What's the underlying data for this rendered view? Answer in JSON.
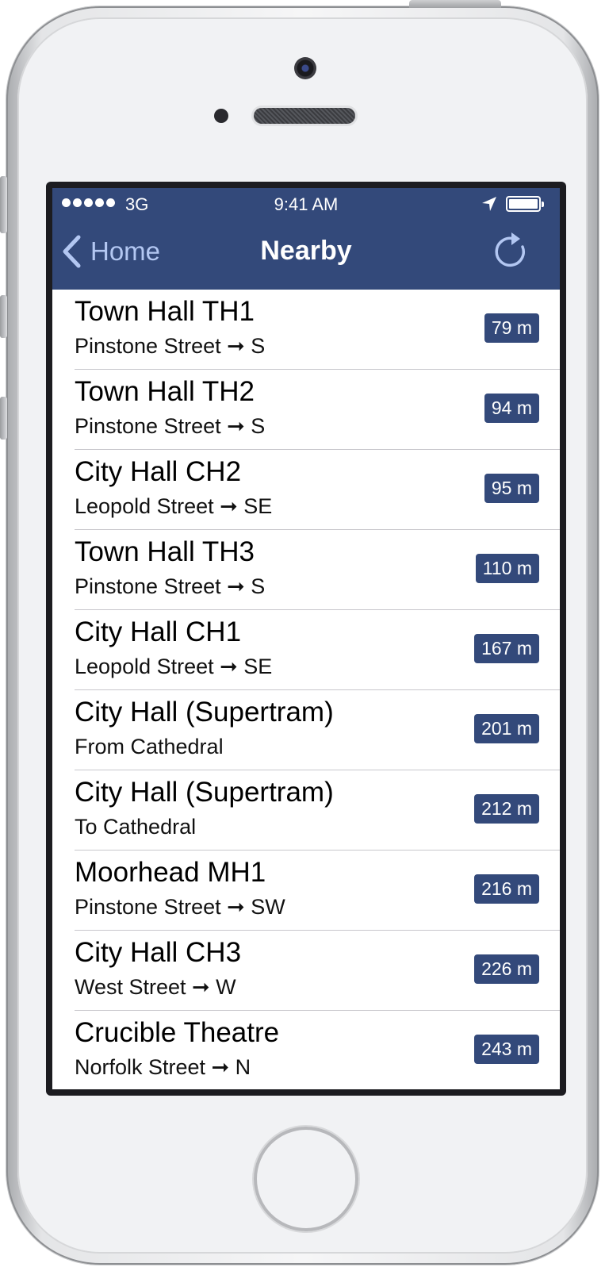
{
  "status_bar": {
    "carrier": "3G",
    "time": "9:41 AM"
  },
  "nav": {
    "back_label": "Home",
    "title": "Nearby"
  },
  "colors": {
    "bar": "#33497a",
    "back_tint": "#b3c7f2",
    "badge": "#33497a"
  },
  "stops": [
    {
      "name": "Town Hall TH1",
      "detail": "Pinstone Street ➞ S",
      "distance": "79 m"
    },
    {
      "name": "Town Hall TH2",
      "detail": "Pinstone Street ➞ S",
      "distance": "94 m"
    },
    {
      "name": "City Hall CH2",
      "detail": "Leopold Street ➞ SE",
      "distance": "95 m"
    },
    {
      "name": "Town Hall TH3",
      "detail": "Pinstone Street ➞ S",
      "distance": "110 m"
    },
    {
      "name": "City Hall CH1",
      "detail": "Leopold Street ➞ SE",
      "distance": "167 m"
    },
    {
      "name": "City Hall (Supertram)",
      "detail": "From Cathedral",
      "distance": "201 m"
    },
    {
      "name": "City Hall (Supertram)",
      "detail": "To Cathedral",
      "distance": "212 m"
    },
    {
      "name": "Moorhead MH1",
      "detail": "Pinstone Street ➞ SW",
      "distance": "216 m"
    },
    {
      "name": "City Hall CH3",
      "detail": "West Street ➞ W",
      "distance": "226 m"
    },
    {
      "name": "Crucible Theatre",
      "detail": "Norfolk Street ➞ N",
      "distance": "243 m"
    }
  ]
}
